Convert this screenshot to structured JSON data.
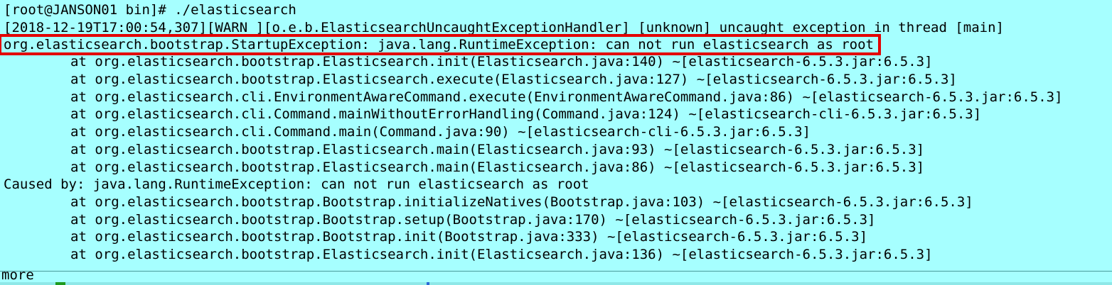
{
  "terminal": {
    "lines": [
      "[root@JANSON01 bin]# ./elasticsearch",
      "[2018-12-19T17:00:54,307][WARN ][o.e.b.ElasticsearchUncaughtExceptionHandler] [unknown] uncaught exception in thread [main]",
      "org.elasticsearch.bootstrap.StartupException: java.lang.RuntimeException: can not run elasticsearch as root",
      "at org.elasticsearch.bootstrap.Elasticsearch.init(Elasticsearch.java:140) ~[elasticsearch-6.5.3.jar:6.5.3]",
      "at org.elasticsearch.bootstrap.Elasticsearch.execute(Elasticsearch.java:127) ~[elasticsearch-6.5.3.jar:6.5.3]",
      "at org.elasticsearch.cli.EnvironmentAwareCommand.execute(EnvironmentAwareCommand.java:86) ~[elasticsearch-6.5.3.jar:6.5.3]",
      "at org.elasticsearch.cli.Command.mainWithoutErrorHandling(Command.java:124) ~[elasticsearch-cli-6.5.3.jar:6.5.3]",
      "at org.elasticsearch.cli.Command.main(Command.java:90) ~[elasticsearch-cli-6.5.3.jar:6.5.3]",
      "at org.elasticsearch.bootstrap.Elasticsearch.main(Elasticsearch.java:93) ~[elasticsearch-6.5.3.jar:6.5.3]",
      "at org.elasticsearch.bootstrap.Elasticsearch.main(Elasticsearch.java:86) ~[elasticsearch-6.5.3.jar:6.5.3]",
      "Caused by: java.lang.RuntimeException: can not run elasticsearch as root",
      "at org.elasticsearch.bootstrap.Bootstrap.initializeNatives(Bootstrap.java:103) ~[elasticsearch-6.5.3.jar:6.5.3]",
      "at org.elasticsearch.bootstrap.Bootstrap.setup(Bootstrap.java:170) ~[elasticsearch-6.5.3.jar:6.5.3]",
      "at org.elasticsearch.bootstrap.Bootstrap.init(Bootstrap.java:333) ~[elasticsearch-6.5.3.jar:6.5.3]",
      "at org.elasticsearch.bootstrap.Elasticsearch.init(Elasticsearch.java:136) ~[elasticsearch-6.5.3.jar:6.5.3]"
    ],
    "more_prompt": "more",
    "colors": {
      "background": "#a6ffff",
      "text": "#000000",
      "highlight_border": "#e30000"
    }
  }
}
